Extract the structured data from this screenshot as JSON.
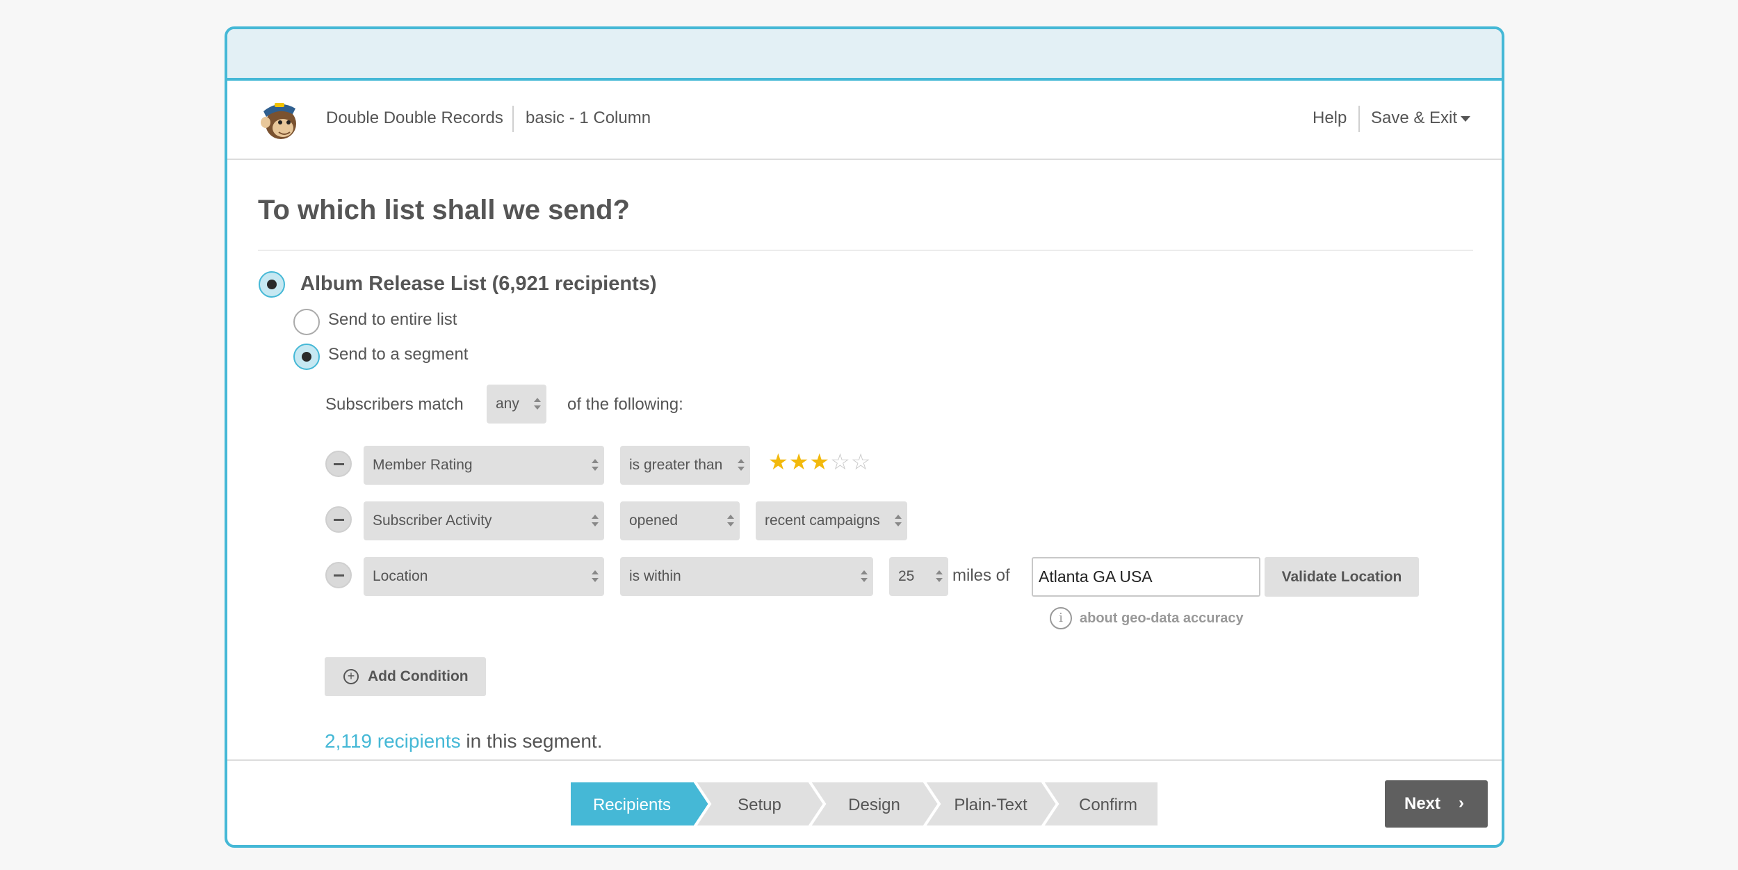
{
  "header": {
    "account": "Double Double Records",
    "template": "basic - 1 Column",
    "help": "Help",
    "save_exit": "Save & Exit"
  },
  "page": {
    "title": "To which list shall we send?",
    "list_name": "Album Release List (6,921 recipients)",
    "options": {
      "entire": "Send to entire list",
      "segment": "Send to a segment",
      "selected": "segment"
    },
    "match": {
      "prefix": "Subscribers match",
      "value": "any",
      "suffix": "of the following:"
    },
    "conditions": [
      {
        "field": "Member Rating",
        "operator": "is greater than",
        "rating": 3,
        "rating_max": 5
      },
      {
        "field": "Subscriber Activity",
        "operator": "opened",
        "value": "recent campaigns"
      },
      {
        "field": "Location",
        "operator": "is within",
        "distance": "25",
        "unit_label": "miles of",
        "location": "Atlanta GA USA",
        "validate_label": "Validate Location"
      }
    ],
    "geo_info": "about geo-data accuracy",
    "info_glyph": "i",
    "add_condition": "Add Condition",
    "plus_glyph": "+",
    "segment_count_link": "2,119 recipients",
    "segment_count_suffix": "in this segment."
  },
  "footer": {
    "steps": [
      "Recipients",
      "Setup",
      "Design",
      "Plain-Text",
      "Confirm"
    ],
    "active_step": 0,
    "next": "Next",
    "next_glyph": "›"
  },
  "colors": {
    "accent": "#45b8d6",
    "star": "#f2b90c",
    "next_bg": "#5f5f5f"
  }
}
